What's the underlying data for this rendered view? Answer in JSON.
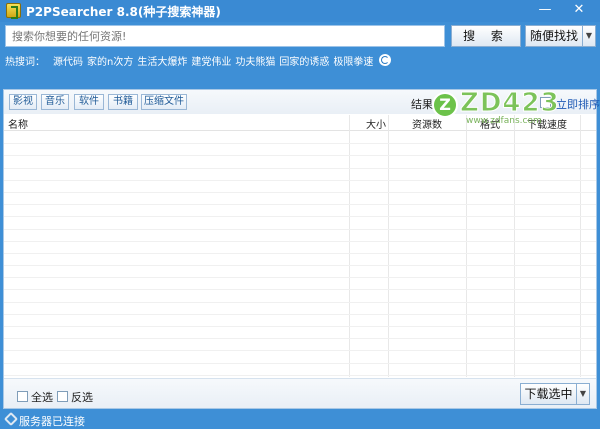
{
  "window": {
    "title": "P2PSearcher 8.8(种子搜索神器)"
  },
  "title_buttons": {
    "minimize": "—",
    "close": "✕"
  },
  "search": {
    "placeholder": "搜索你想要的任何资源!",
    "search_label": "搜 索",
    "random_label": "随便找找",
    "arrow": "▼"
  },
  "hot": {
    "label": "热搜词：",
    "items": [
      "源代码",
      "家的n次方",
      "生活大爆炸",
      "建党伟业",
      "功夫熊猫",
      "回家的诱惑",
      "极限拳速"
    ]
  },
  "categories": [
    "影视",
    "音乐",
    "软件",
    "书籍",
    "压缩文件"
  ],
  "results": {
    "label": "结果",
    "sort_label": "立即排序"
  },
  "table": {
    "columns": [
      "名称",
      "大小",
      "资源数",
      "格式",
      "下载速度"
    ],
    "rows": []
  },
  "bottom": {
    "select_all": "全选",
    "invert": "反选",
    "download_label": "下载选中",
    "arrow": "▼"
  },
  "status": {
    "text": "服务器已连接"
  },
  "watermark": {
    "mark": "Z",
    "text": "ZD423",
    "sub": "www.zdfans.com"
  },
  "colors": {
    "frame": "#3e8fd6",
    "title_bar": "#3a8ad3",
    "link": "#1f5ab5"
  }
}
